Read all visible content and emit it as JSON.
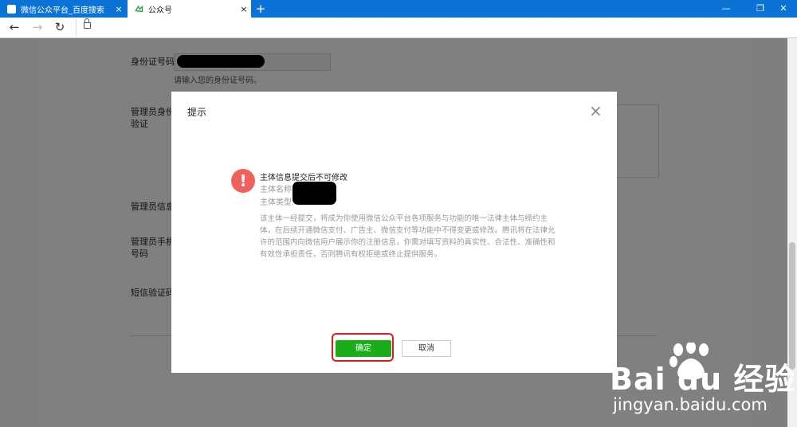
{
  "browser": {
    "tabs": [
      {
        "title": "微信公众平台_百度搜索",
        "close": "×"
      },
      {
        "title": "公众号",
        "close": "×"
      }
    ],
    "new_tab": "+",
    "controls": {
      "minimize": "—",
      "restore": "❐",
      "close": "✕"
    },
    "nav": {
      "back": "←",
      "forward": "→",
      "reload": "↻"
    }
  },
  "form": {
    "id_label": "身份证号码",
    "id_hint": "请输入您的身份证号码。",
    "admin_verify_label_1": "管理员身份",
    "admin_verify_label_2": "验证",
    "admin_info_label": "管理员信息登",
    "admin_phone_label_1": "管理员手机",
    "admin_phone_label_2": "号码",
    "sms_label": "短信验证码"
  },
  "modal": {
    "title": "提示",
    "close": "×",
    "warning_mark": "!",
    "heading": "主体信息提交后不可修改",
    "entity_name_label": "主体名称:",
    "entity_type_label": "主体类型:",
    "description": "该主体一经提交，将成为你使用微信公众平台各项服务与功能的唯一法律主体与缔约主体，在后续开通微信支付、广告主、微信支付等功能中不得变更或修改。腾讯将在法律允许的范围内向微信用户展示你的注册信息，你需对填写资料的真实性、合法性、准确性和有效性承担责任，否则腾讯有权拒绝或终止提供服务。",
    "confirm": "确定",
    "cancel": "取消"
  },
  "watermark": {
    "brand": "Bai du 经验",
    "url": "jingyan.baidu.com"
  },
  "colors": {
    "tabbar": "#0b73d5",
    "confirm": "#1aad19",
    "warning": "#f0605c",
    "highlight": "#d61f24"
  }
}
